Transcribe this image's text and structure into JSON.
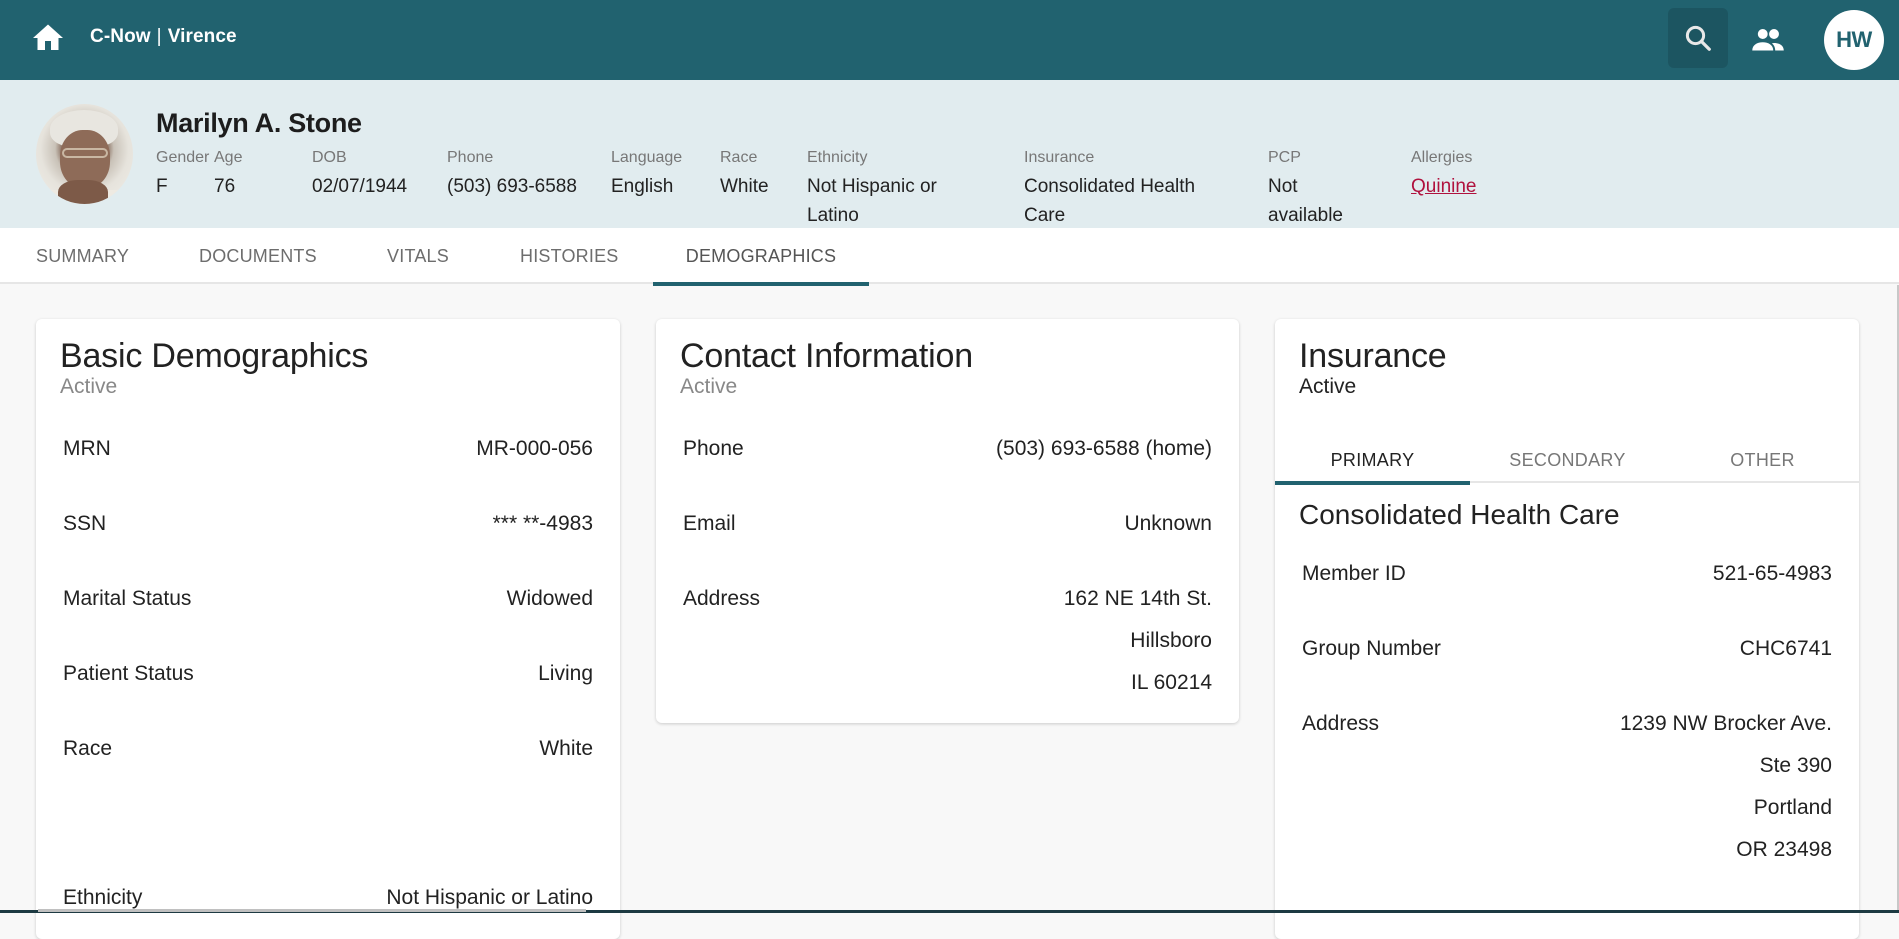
{
  "app": {
    "title_left": "C-Now",
    "title_sep": "|",
    "title_right": "Virence",
    "user_initials": "HW",
    "icons": {
      "home": "home-icon",
      "search": "search-icon",
      "people": "people-icon"
    },
    "colors": {
      "brand": "#21626f",
      "header_bg": "#e1ecef",
      "allergy_link": "#b0123e"
    }
  },
  "patient": {
    "name": "Marilyn A. Stone",
    "fields": [
      {
        "label": "Gender",
        "value": "F"
      },
      {
        "label": "Age",
        "value": "76"
      },
      {
        "label": "DOB",
        "value": "02/07/1944"
      },
      {
        "label": "Phone",
        "value": "(503) 693-6588"
      },
      {
        "label": "Language",
        "value": "English"
      },
      {
        "label": "Race",
        "value": "White"
      },
      {
        "label": "Ethnicity",
        "value_line1": "Not Hispanic or",
        "value_line2": "Latino"
      },
      {
        "label": "Insurance",
        "value_line1": "Consolidated Health",
        "value_line2": "Care"
      },
      {
        "label": "PCP",
        "value_line1": "Not",
        "value_line2": "available"
      },
      {
        "label": "Allergies",
        "value": "Quinine"
      }
    ]
  },
  "tabs": [
    {
      "label": "SUMMARY"
    },
    {
      "label": "DOCUMENTS"
    },
    {
      "label": "VITALS"
    },
    {
      "label": "HISTORIES"
    },
    {
      "label": "DEMOGRAPHICS",
      "active": true
    }
  ],
  "basic": {
    "title": "Basic Demographics",
    "status": "Active",
    "rows": [
      {
        "label": "MRN",
        "value": "MR-000-056"
      },
      {
        "label": "SSN",
        "value": "*** **-4983"
      },
      {
        "label": "Marital Status",
        "value": "Widowed"
      },
      {
        "label": "Patient Status",
        "value": "Living"
      },
      {
        "label": "Race",
        "value": "White"
      },
      {
        "label": "Ethnicity",
        "value": "Not Hispanic or Latino"
      }
    ]
  },
  "contact": {
    "title": "Contact Information",
    "status": "Active",
    "rows": [
      {
        "label": "Phone",
        "value": "(503) 693-6588 (home)"
      },
      {
        "label": "Email",
        "value": "Unknown"
      },
      {
        "label": "Address",
        "lines": [
          "162 NE 14th St.",
          "Hillsboro",
          "IL 60214"
        ]
      }
    ]
  },
  "insurance": {
    "title": "Insurance",
    "status": "Active",
    "tabs": [
      {
        "label": "PRIMARY",
        "active": true
      },
      {
        "label": "SECONDARY"
      },
      {
        "label": "OTHER"
      }
    ],
    "plan_name": "Consolidated Health Care",
    "rows": [
      {
        "label": "Member ID",
        "value": "521-65-4983"
      },
      {
        "label": "Group Number",
        "value": "CHC6741"
      },
      {
        "label": "Address",
        "lines": [
          "1239 NW Brocker Ave.",
          "Ste 390",
          "Portland",
          "OR 23498"
        ]
      }
    ]
  }
}
